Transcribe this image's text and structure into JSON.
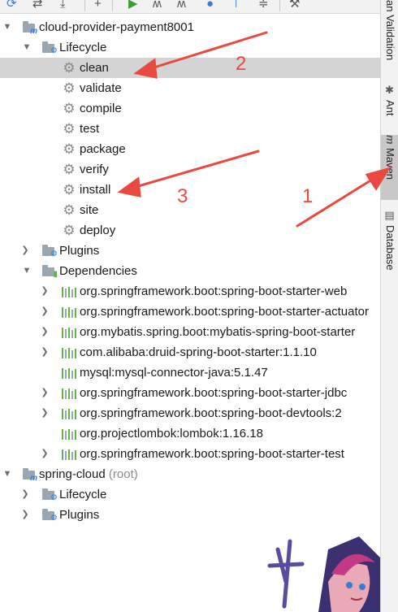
{
  "toolbar": {
    "icons": [
      "refresh-icon",
      "reimport-icon",
      "download-icon",
      "add-icon",
      "run-icon",
      "toggle-offline-icon",
      "skip-tests-icon",
      "lightning-icon",
      "show-dependencies-icon",
      "collapse-all-icon",
      "settings-icon"
    ]
  },
  "tree": {
    "project1": "cloud-provider-payment8001",
    "lifecycle": "Lifecycle",
    "phases": [
      "clean",
      "validate",
      "compile",
      "test",
      "package",
      "verify",
      "install",
      "site",
      "deploy"
    ],
    "plugins": "Plugins",
    "dependencies": "Dependencies",
    "deps": [
      "org.springframework.boot:spring-boot-starter-web",
      "org.springframework.boot:spring-boot-starter-actuator",
      "org.mybatis.spring.boot:mybatis-spring-boot-starter",
      "com.alibaba:druid-spring-boot-starter:1.1.10",
      "mysql:mysql-connector-java:5.1.47",
      "org.springframework.boot:spring-boot-starter-jdbc",
      "org.springframework.boot:spring-boot-devtools:2",
      "org.projectlombok:lombok:1.16.18",
      "org.springframework.boot:spring-boot-starter-test"
    ],
    "project2": "spring-cloud",
    "project2_suffix": "(root)",
    "lifecycle2": "Lifecycle",
    "plugins2": "Plugins"
  },
  "sidebar": {
    "tab_validation": "an Validation",
    "tab_ant": "Ant",
    "tab_maven": "Maven",
    "tab_database": "Database"
  },
  "annotations": {
    "n1": "1",
    "n2": "2",
    "n3": "3",
    "color": "#e84a3f"
  }
}
